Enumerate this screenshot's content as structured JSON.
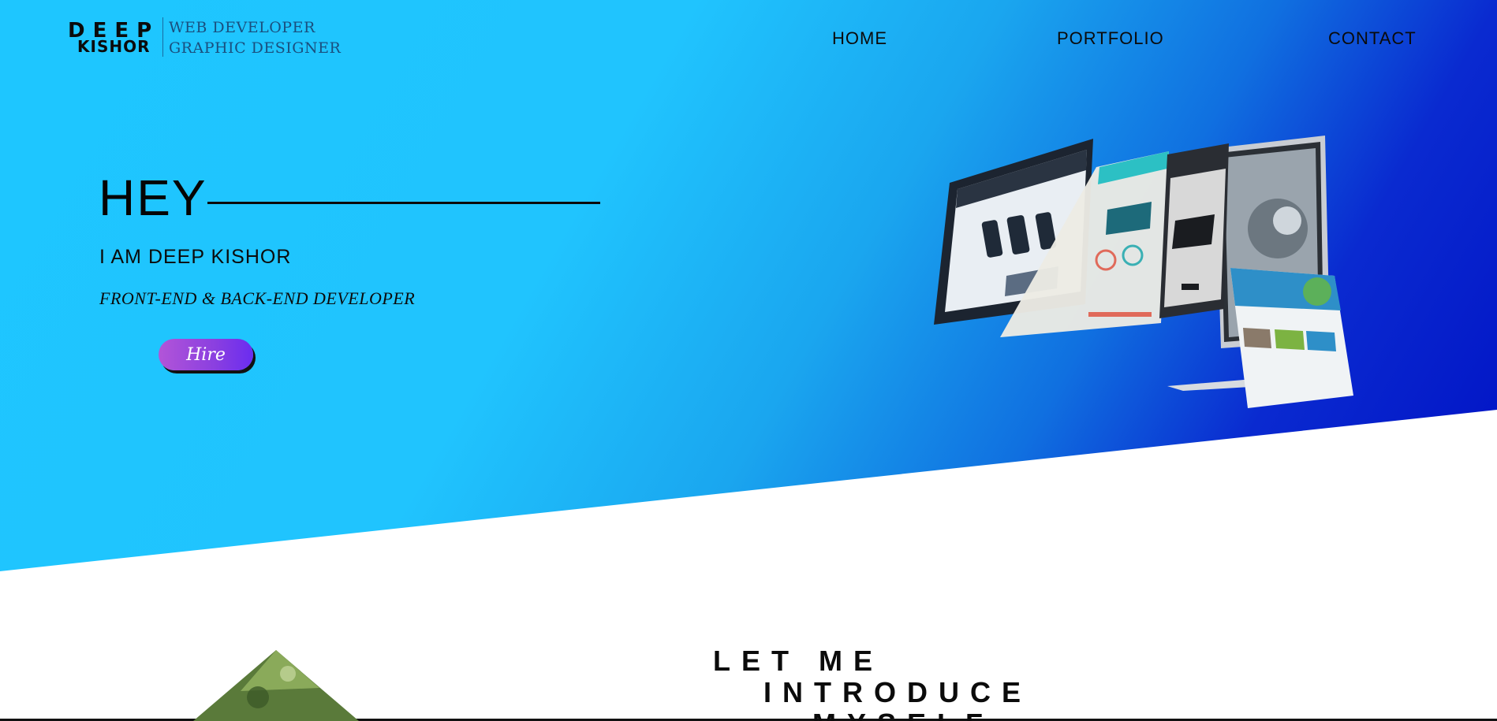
{
  "brand": {
    "name_line1": "DEEP",
    "name_line2": "KISHOR",
    "tagline1": "WEB DEVELOPER",
    "tagline2": "GRAPHIC DESIGNER"
  },
  "nav": {
    "items": [
      {
        "label": "HOME"
      },
      {
        "label": "PORTFOLIO"
      },
      {
        "label": "CONTACT"
      }
    ]
  },
  "hero": {
    "greeting": "HEY",
    "name": "I AM DEEP KISHOR",
    "role": "FRONT-END & BACK-END DEVELOPER",
    "cta_label": "Hire",
    "illustration_icon": "website-screens-monitor",
    "colors": {
      "gradient_start": "#1ec6ff",
      "gradient_end": "#0010c4",
      "button_start": "#b255d8",
      "button_end": "#6a2cf0"
    }
  },
  "about": {
    "title_line1": "LET ME",
    "title_line2": "INTRODUCE",
    "title_line3": "MYSELF",
    "photo_icon": "profile-photo-diamond"
  }
}
